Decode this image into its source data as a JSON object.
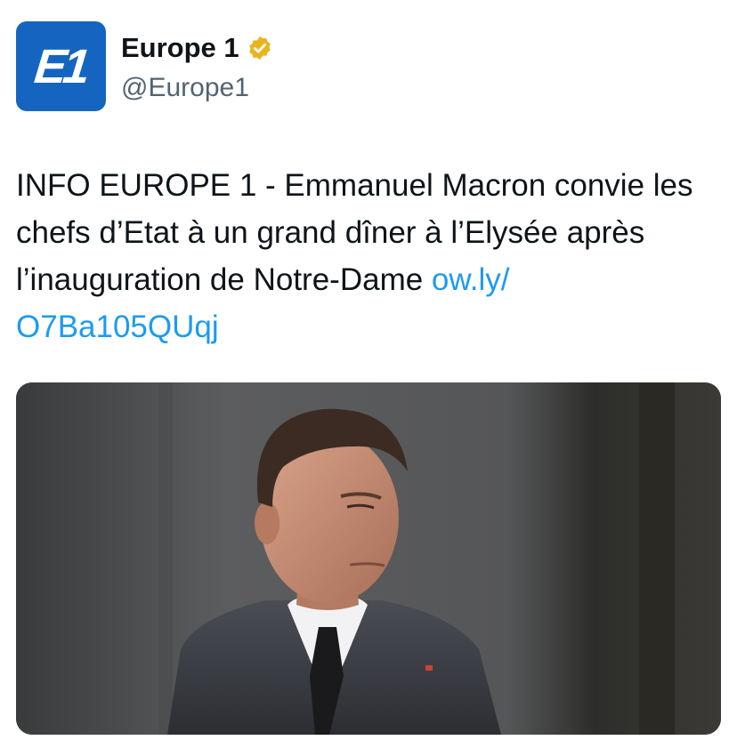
{
  "account": {
    "avatar_text": "E1",
    "display_name": "Europe 1",
    "handle": "@Europe1",
    "verified_badge": "verified-gold-icon"
  },
  "tweet": {
    "text": "INFO EUROPE 1 - Emmanuel Macron convie les chefs d’Etat à un grand dîner à l’Elysée après l’inauguration de Notre-Dame ",
    "link_line1": "ow.ly/",
    "link_line2": "O7Ba105QUqj"
  },
  "media": {
    "subject": "portrait-photo"
  },
  "colors": {
    "brand_blue": "#1565c0",
    "link": "#1d9bf0",
    "verified_gold": "#e8b520",
    "handle_gray": "#536471"
  }
}
